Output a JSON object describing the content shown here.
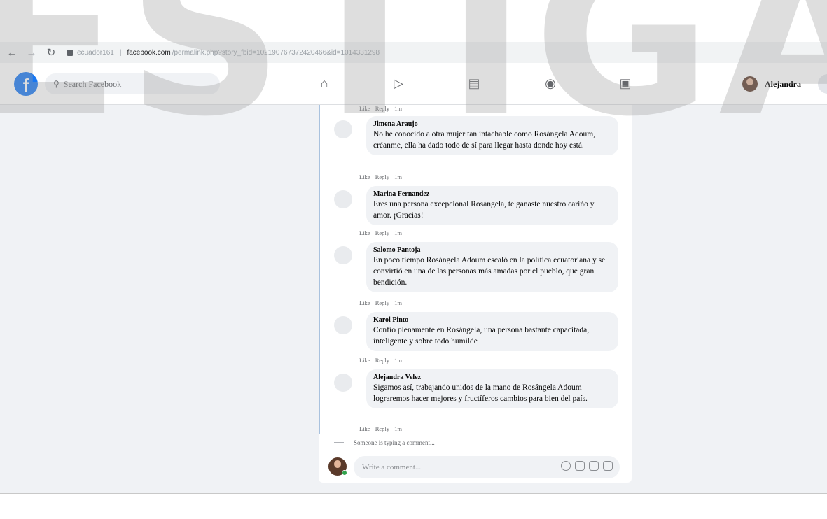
{
  "browser": {
    "back_icon": "arrow-left-icon",
    "forward_icon": "arrow-right-icon",
    "reload_icon": "reload-icon",
    "url_prefix": "ecuador161",
    "url_host": "facebook.com",
    "url_path": "/permalink.php?story_fbid=102190767372420466&id=1014331298"
  },
  "fb": {
    "search_placeholder": "Search Facebook",
    "user_name": "Alejandra",
    "nav_icons": [
      "home-icon",
      "watch-icon",
      "marketplace-icon",
      "groups-icon",
      "gaming-icon"
    ]
  },
  "watermark": {
    "text": "ESTIGAC"
  },
  "comments": [
    {
      "name": "",
      "text": "",
      "actions": [
        "Like",
        "Reply",
        "1m"
      ]
    },
    {
      "name": "Jimena Araujo",
      "text": "No he conocido a otra mujer tan intachable como Rosángela Adoum, créanme, ella ha dado todo de sí para llegar hasta donde hoy está.",
      "actions": [
        "Like",
        "Reply",
        "1m"
      ]
    },
    {
      "name": "Marina Fernandez",
      "text": "Eres una persona excepcional Rosángela, te ganaste nuestro cariño y amor. ¡Gracias!",
      "actions": [
        "Like",
        "Reply",
        "1m"
      ]
    },
    {
      "name": "Salomo Pantoja",
      "text": "En poco tiempo Rosángela Adoum escaló en la política ecuatoriana y se convirtió en una de las personas más amadas por el pueblo, que gran bendición.",
      "actions": [
        "Like",
        "Reply",
        "1m"
      ]
    },
    {
      "name": "Karol Pinto",
      "text": "Confío plenamente en Rosángela, una persona bastante capacitada, inteligente y sobre todo humilde",
      "actions": [
        "Like",
        "Reply",
        "1m"
      ]
    },
    {
      "name": "Alejandra Velez",
      "text": "Sigamos así, trabajando unidos de la mano de Rosángela Adoum lograremos hacer mejores y fructíferos cambios para bien del país.",
      "actions": [
        "Like",
        "Reply",
        "1m"
      ]
    }
  ],
  "typing_text": "Someone is typing a comment...",
  "composer": {
    "placeholder": "Write a comment...",
    "icons": [
      "emoji-icon",
      "camera-icon",
      "gif-icon",
      "sticker-icon"
    ]
  }
}
